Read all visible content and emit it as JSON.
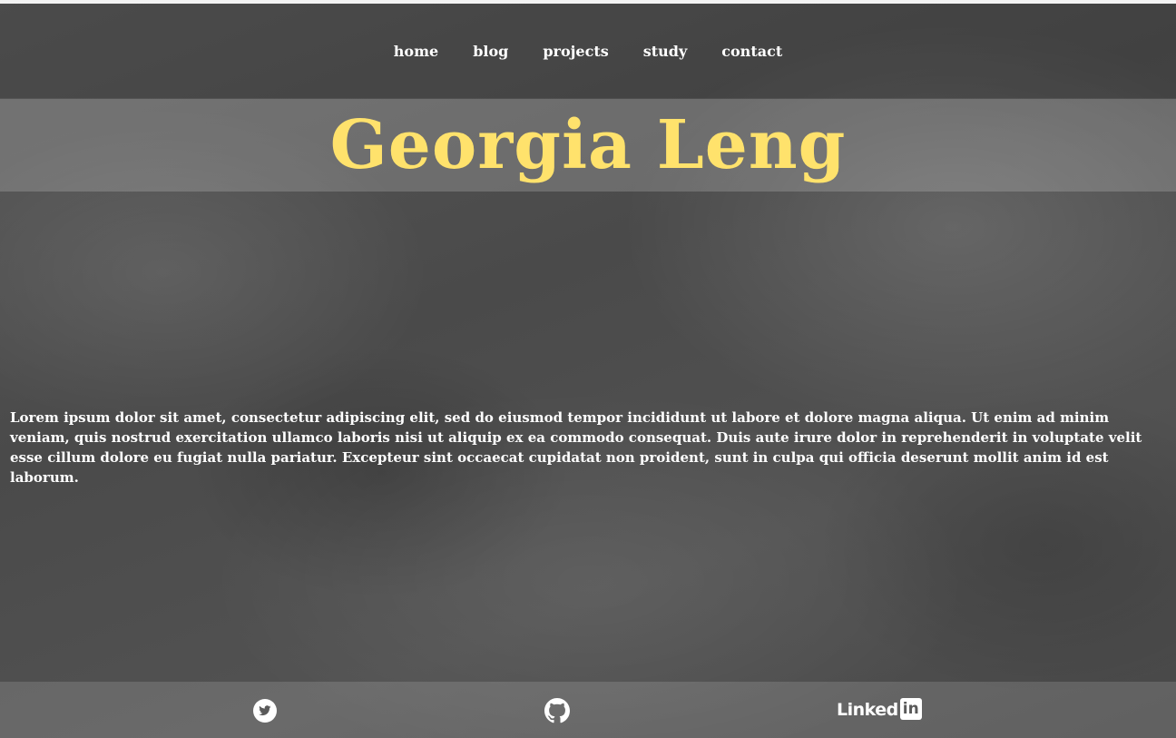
{
  "nav": {
    "items": [
      {
        "label": "home"
      },
      {
        "label": "blog"
      },
      {
        "label": "projects"
      },
      {
        "label": "study"
      },
      {
        "label": "contact"
      }
    ]
  },
  "hero": {
    "title": "Georgia Leng"
  },
  "main": {
    "paragraph": "Lorem ipsum dolor sit amet, consectetur adipiscing elit, sed do eiusmod tempor incididunt ut labore et dolore magna aliqua. Ut enim ad minim veniam, quis nostrud exercitation ullamco laboris nisi ut aliquip ex ea commodo consequat. Duis aute irure dolor in reprehenderit in voluptate velit esse cillum dolore eu fugiat nulla pariatur. Excepteur sint occaecat cupidatat non proident, sunt in culpa qui officia deserunt mollit anim id est laborum."
  },
  "footer": {
    "social": [
      {
        "icon": "twitter-icon"
      },
      {
        "icon": "github-icon"
      },
      {
        "icon": "linkedin-logo",
        "wordmark": "Linked",
        "badge": "in"
      }
    ]
  },
  "colors": {
    "title": "#ffe26c",
    "text": "#ffffff",
    "background": "#4b4b4b"
  }
}
